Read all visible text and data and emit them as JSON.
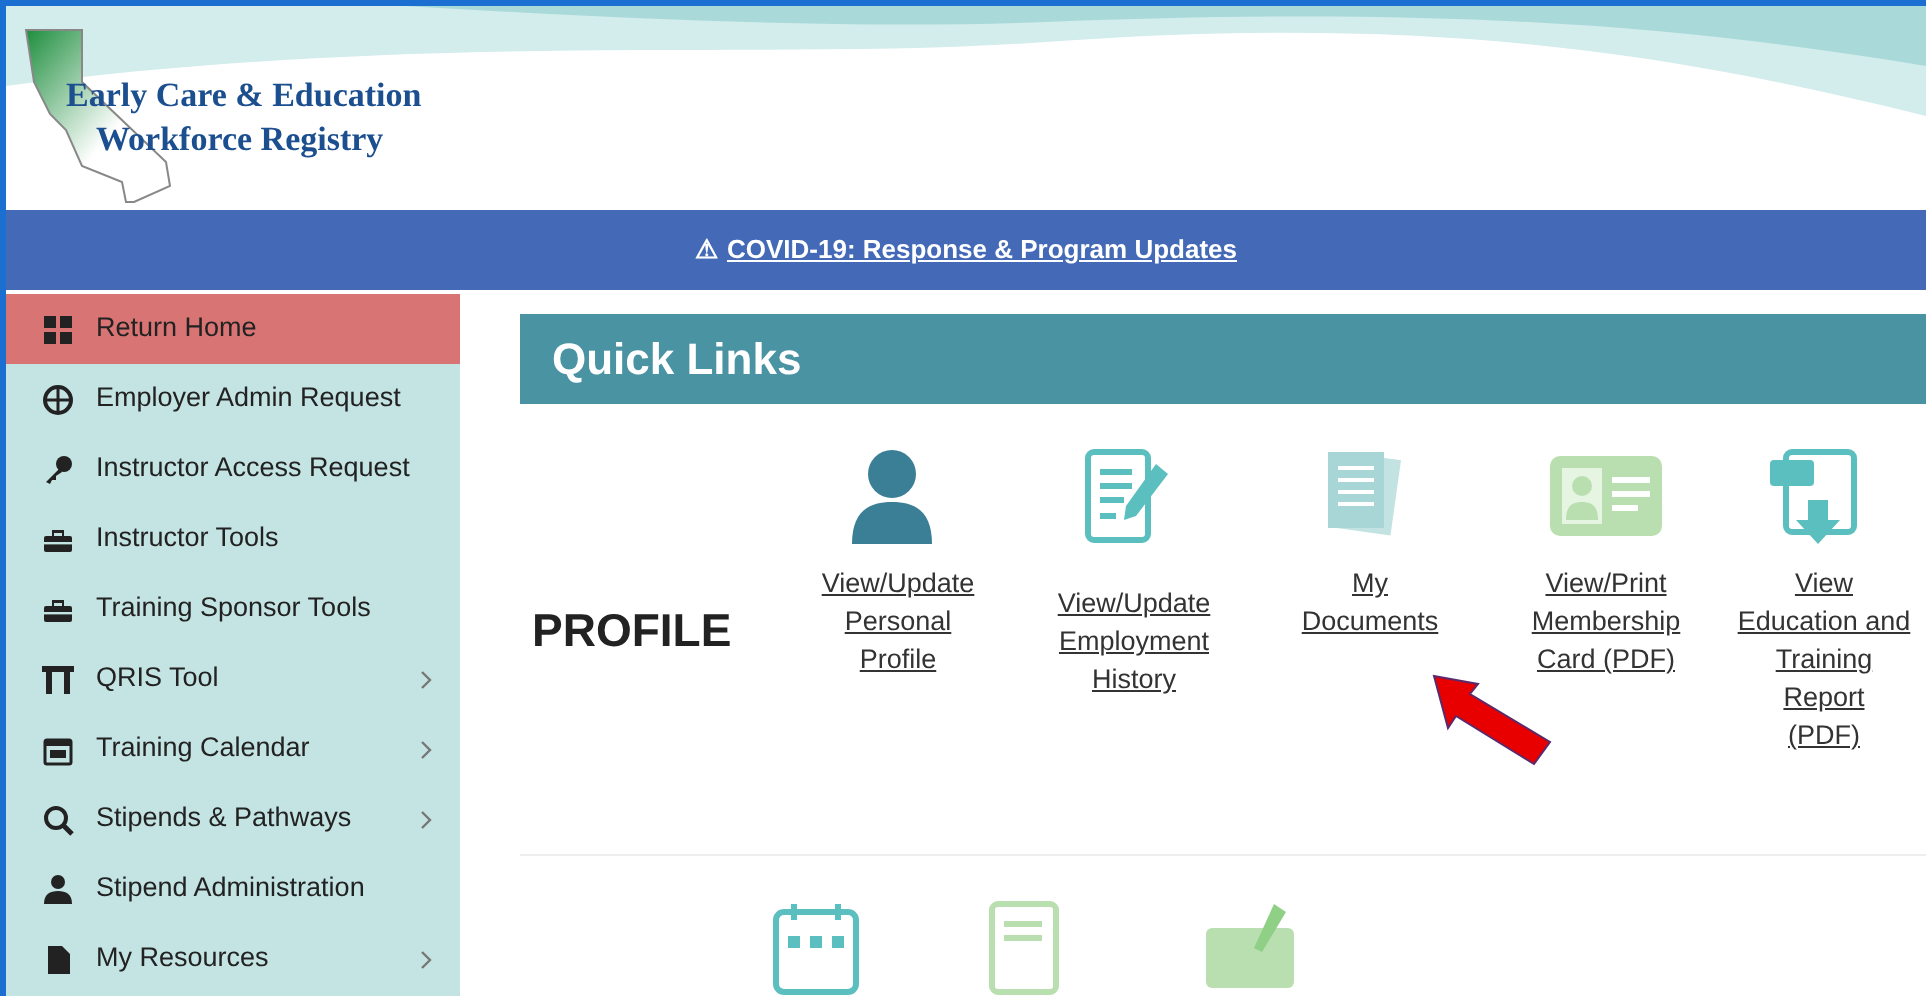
{
  "header": {
    "logo_line_1": "Early Care & Education",
    "logo_line_2": "Workforce Registry"
  },
  "banner": {
    "icon": "⚠",
    "link": "COVID-19: Response & Program Updates"
  },
  "sidebar": {
    "items": [
      {
        "kind": "grid",
        "label": "Return Home",
        "selected": true,
        "submenu": false
      },
      {
        "kind": "globe",
        "label": "Employer Admin Request",
        "selected": false,
        "submenu": false
      },
      {
        "kind": "key",
        "label": "Instructor Access Request",
        "selected": false,
        "submenu": false
      },
      {
        "kind": "toolbox",
        "label": "Instructor Tools",
        "selected": false,
        "submenu": false
      },
      {
        "kind": "toolbox",
        "label": "Training Sponsor Tools",
        "selected": false,
        "submenu": false
      },
      {
        "kind": "gate",
        "label": "QRIS Tool",
        "selected": false,
        "submenu": true
      },
      {
        "kind": "calendar",
        "label": "Training Calendar",
        "selected": false,
        "submenu": true
      },
      {
        "kind": "search",
        "label": "Stipends & Pathways",
        "selected": false,
        "submenu": true
      },
      {
        "kind": "person",
        "label": "Stipend Administration",
        "selected": false,
        "submenu": false
      },
      {
        "kind": "file",
        "label": "My Resources",
        "selected": false,
        "submenu": true
      }
    ]
  },
  "quick_links": {
    "title": "Quick Links",
    "section": "PROFILE",
    "links": [
      {
        "kind": "person",
        "label": "View/Update\nPersonal\nProfile"
      },
      {
        "kind": "form",
        "label": "View/Update\nEmployment\nHistory"
      },
      {
        "kind": "documents",
        "label": "My\nDocuments"
      },
      {
        "kind": "card",
        "label": "View/Print\nMembership\nCard (PDF)"
      },
      {
        "kind": "pdf",
        "label": "View\nEducation and\nTraining\nReport\n(PDF)"
      }
    ],
    "next_row_icons": [
      {
        "kind": "calendar"
      },
      {
        "kind": "document"
      },
      {
        "kind": "cheque"
      }
    ]
  }
}
